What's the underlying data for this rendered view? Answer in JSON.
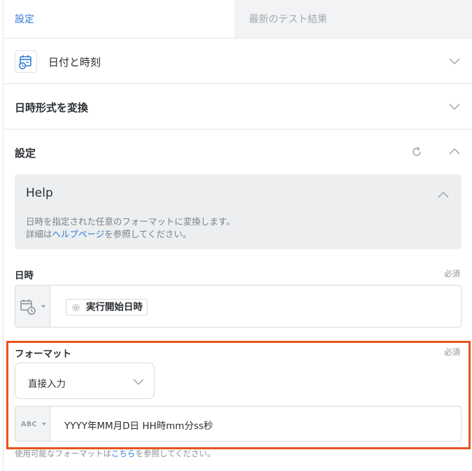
{
  "tabs": {
    "settings": "設定",
    "latest_test_result": "最新のテスト結果"
  },
  "app": {
    "name": "日付と時刻",
    "icon": "calendar-clock-icon"
  },
  "action": {
    "title": "日時形式を変換"
  },
  "settings": {
    "title": "設定",
    "help": {
      "title": "Help",
      "line1": "日時を指定された任意のフォーマットに変換します。",
      "line2_prefix": "詳細は",
      "line2_link": "ヘルプページ",
      "line2_suffix": "を参照してください。"
    },
    "datetime_field": {
      "label": "日時",
      "required": "必須",
      "value": "実行開始日時"
    },
    "format_field": {
      "label": "フォーマット",
      "required": "必須",
      "mode": "直接入力",
      "type_badge": "ABC",
      "value": "YYYY年MM月D日 HH時mm分ss秒",
      "note_prefix": "使用可能なフォーマットは",
      "note_link": "こちら",
      "note_suffix": "を参照してください。"
    }
  },
  "colors": {
    "accent": "#2f7bd6",
    "highlight": "#e8541c"
  }
}
